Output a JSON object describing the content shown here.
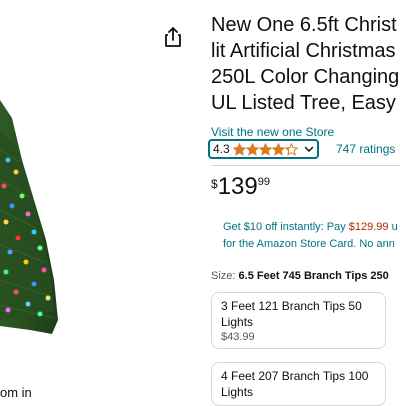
{
  "left": {
    "zoom_text": "om in"
  },
  "product": {
    "title_lines": [
      "New One 6.5ft Christ",
      "lit Artificial Christmas",
      "250L Color Changing",
      "UL Listed Tree, Easy"
    ],
    "store_link": "Visit the new one Store",
    "rating_value": "4.3",
    "rating_stars": 4.3,
    "ratings_count": "747 ratings",
    "price": {
      "symbol": "$",
      "whole": "139",
      "fraction": "99"
    },
    "promo": {
      "line1_prefix": "Get $10 off instantly: Pay ",
      "line1_price": "$129.99",
      "line1_suffix": " u",
      "line2": "for the Amazon Store Card. No ann"
    },
    "size": {
      "label": "Size: ",
      "selected": "6.5 Feet 745 Branch Tips 250"
    },
    "options": [
      {
        "name_line1": "3 Feet 121 Branch Tips 50",
        "name_line2": "Lights",
        "price": "$43.99"
      },
      {
        "name_line1": "4 Feet 207 Branch Tips 100",
        "name_line2": "Lights",
        "price": ""
      }
    ]
  },
  "colors": {
    "link": "#007185",
    "star": "#de7921",
    "price_red": "#b12704"
  },
  "icons": {
    "share": "share-icon",
    "chevron": "chevron-down-icon"
  }
}
